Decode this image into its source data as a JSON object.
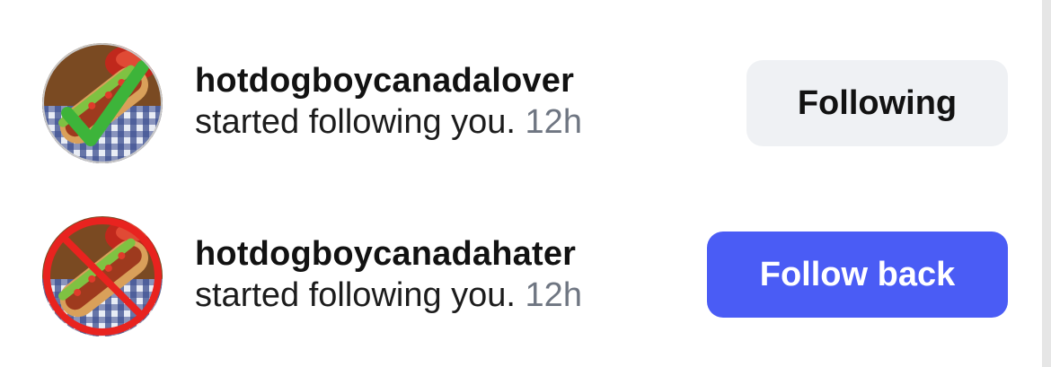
{
  "notifications": [
    {
      "username": "hotdogboycanadalover",
      "activity": "started following you.",
      "time": "12h",
      "button_label": "Following",
      "avatar_overlay": "green-checkmark-icon"
    },
    {
      "username": "hotdogboycanadahater",
      "activity": "started following you.",
      "time": "12h",
      "button_label": "Follow back",
      "avatar_overlay": "red-prohibited-icon"
    }
  ],
  "colors": {
    "follow_back_bg": "#4a5cf5",
    "following_bg": "#eff1f4",
    "timestamp": "#6f7682",
    "check_green": "#3db43a",
    "prohibit_red": "#e8231f"
  }
}
